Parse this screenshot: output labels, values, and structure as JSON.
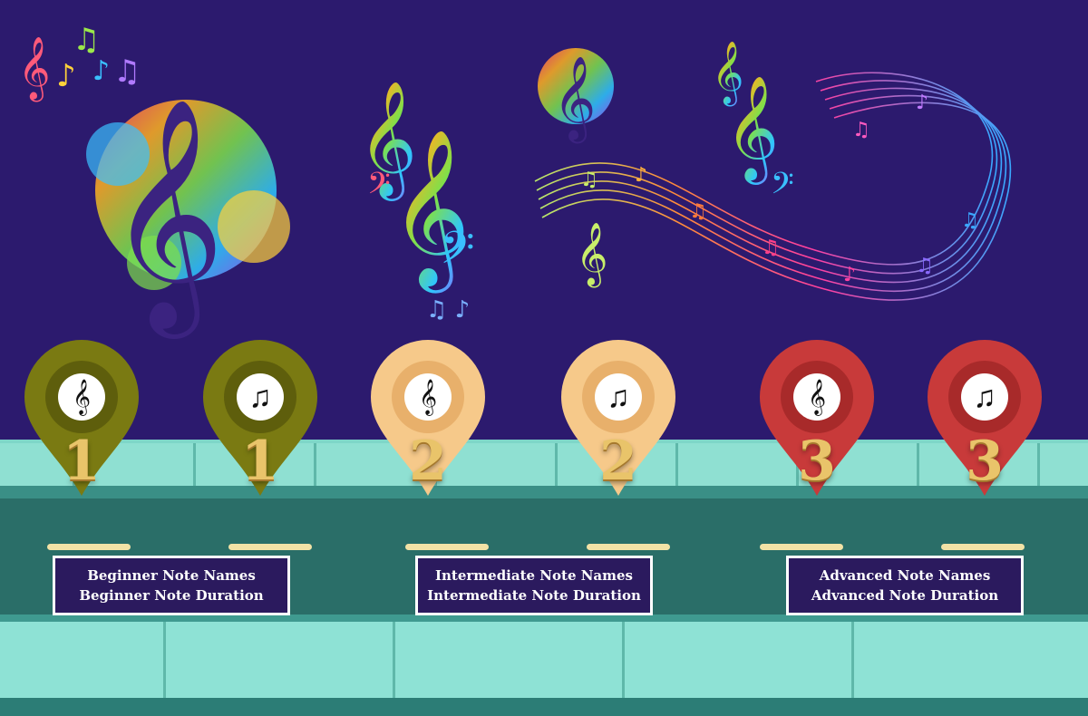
{
  "levels": [
    {
      "number": "1",
      "title": "Beginner Note Names",
      "subtitle": "Beginner Note Duration",
      "color": "#7a7a12",
      "inner": "#5e5e0c"
    },
    {
      "number": "2",
      "title": "Intermediate Note Names",
      "subtitle": "Intermediate Note Duration",
      "color": "#f6c98a",
      "inner": "#e8b06b"
    },
    {
      "number": "3",
      "title": "Advanced Note Names",
      "subtitle": "Advanced Note Duration",
      "color": "#c83a3a",
      "inner": "#a82a2a"
    }
  ],
  "pins": [
    {
      "number": "1",
      "icon": "treble-clef-staff-icon",
      "glyph": "𝄞"
    },
    {
      "number": "1",
      "icon": "music-notes-icon",
      "glyph": "♫"
    },
    {
      "number": "2",
      "icon": "treble-clef-staff-icon",
      "glyph": "𝄞"
    },
    {
      "number": "2",
      "icon": "music-notes-icon",
      "glyph": "♫"
    },
    {
      "number": "3",
      "icon": "treble-clef-staff-icon",
      "glyph": "𝄞"
    },
    {
      "number": "3",
      "icon": "music-notes-icon",
      "glyph": "♫"
    }
  ],
  "decorations": [
    "treble-clef-splash-icon",
    "rainbow-clef-notes-icon",
    "music-staff-wave-icon",
    "colorful-notes-icon"
  ]
}
